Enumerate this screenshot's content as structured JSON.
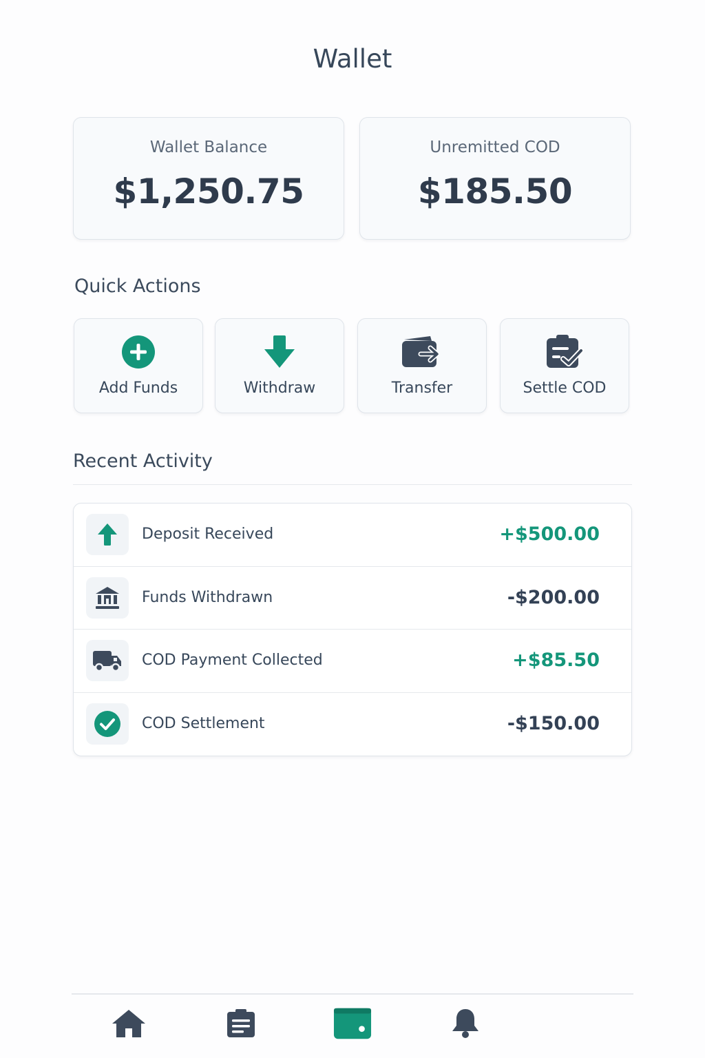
{
  "header": {
    "title": "Wallet"
  },
  "balances": {
    "wallet": {
      "label": "Wallet Balance",
      "amount": "$1,250.75"
    },
    "unremitted": {
      "label": "Unremitted COD",
      "amount": "$185.50"
    }
  },
  "quick_actions": {
    "title": "Quick Actions",
    "items": [
      {
        "label": "Add Funds",
        "icon": "plus-circle-icon"
      },
      {
        "label": "Withdraw",
        "icon": "arrow-down-icon"
      },
      {
        "label": "Transfer",
        "icon": "wallet-transfer-icon"
      },
      {
        "label": "Settle COD",
        "icon": "clipboard-check-icon"
      }
    ]
  },
  "recent_activity": {
    "title": "Recent Activity",
    "items": [
      {
        "description": "Deposit Received",
        "amount": "+$500.00",
        "type": "credit",
        "icon": "arrow-up-icon"
      },
      {
        "description": "Funds Withdrawn",
        "amount": "-$200.00",
        "type": "debit",
        "icon": "bank-icon"
      },
      {
        "description": "COD Payment Collected",
        "amount": "+$85.50",
        "type": "credit",
        "icon": "truck-icon"
      },
      {
        "description": "COD Settlement",
        "amount": "-$150.00",
        "type": "debit",
        "icon": "check-circle-icon"
      }
    ]
  },
  "bottom_nav": {
    "items": [
      {
        "icon": "home-icon",
        "active": false
      },
      {
        "icon": "orders-icon",
        "active": false
      },
      {
        "icon": "wallet-icon",
        "active": true
      },
      {
        "icon": "bell-icon",
        "active": false
      }
    ]
  },
  "colors": {
    "accent": "#14967a",
    "text_dark": "#334155",
    "icon_dark": "#3d4a5c"
  }
}
